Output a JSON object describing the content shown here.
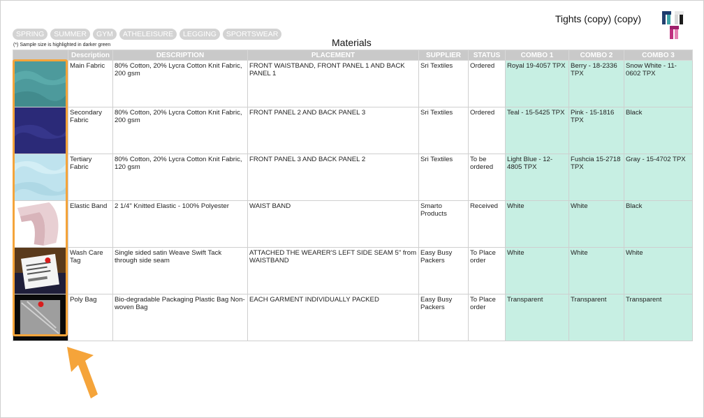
{
  "style_name": "Tights (copy) (copy)",
  "section_title": "Materials",
  "tags": [
    "SPRING",
    "SUMMER",
    "GYM",
    "ATHELEISURE",
    "LEGGING",
    "SPORTSWEAR"
  ],
  "note": "(*) Sample size is highlighted in darker green",
  "columns": [
    "",
    "Description",
    "DESCRIPTION",
    "PLACEMENT",
    "SUPPLIER",
    "STATUS",
    "COMBO 1",
    "COMBO 2",
    "COMBO 3"
  ],
  "rows": [
    {
      "image": "teal-fabric-swatch",
      "name": "Main Fabric",
      "description": "80% Cotton, 20% Lycra Cotton Knit Fabric, 200 gsm",
      "placement": "FRONT WAISTBAND, FRONT PANEL 1 AND BACK PANEL 1",
      "supplier": "Sri Textiles",
      "status": "Ordered",
      "combo1": "Royal 19-4057 TPX",
      "combo2": "Berry - 18-2336 TPX",
      "combo3": "Snow White - 11-0602 TPX"
    },
    {
      "image": "navy-fabric-swatch",
      "name": "Secondary Fabric",
      "description": "80% Cotton, 20% Lycra Cotton Knit Fabric, 200 gsm",
      "placement": "FRONT PANEL 2 AND BACK PANEL 3",
      "supplier": "Sri Textiles",
      "status": "Ordered",
      "combo1": "Teal - 15-5425 TPX",
      "combo2": "Pink - 15-1816 TPX",
      "combo3": "Black"
    },
    {
      "image": "light-blue-fabric-swatch",
      "name": "Tertiary Fabric",
      "description": "80% Cotton, 20% Lycra Cotton Knit Fabric, 120 gsm",
      "placement": "FRONT PANEL 3 AND BACK PANEL 2",
      "supplier": "Sri Textiles",
      "status": "To be ordered",
      "combo1": "Light Blue - 12-4805 TPX",
      "combo2": "Fushcia 15-2718 TPX",
      "combo3": "Gray - 15-4702 TPX"
    },
    {
      "image": "elastic-band-photo",
      "name": "Elastic Band",
      "description": "2 1/4\" Knitted Elastic - 100% Polyester",
      "placement": "WAIST BAND",
      "supplier": "Smarto Products",
      "status": "Received",
      "combo1": "White",
      "combo2": "White",
      "combo3": "Black"
    },
    {
      "image": "wash-care-tag-photo",
      "name": "Wash Care Tag",
      "description": "Single sided satin Weave Swift Tack through side seam",
      "placement": "ATTACHED THE WEARER'S LEFT SIDE SEAM 5\" from WAISTBAND",
      "supplier": "Easy Busy Packers",
      "status": "To Place order",
      "combo1": "White",
      "combo2": "White",
      "combo3": "White"
    },
    {
      "image": "poly-bag-photo",
      "name": "Poly Bag",
      "description": "Bio-degradable Packaging Plastic Bag Non-woven Bag",
      "placement": "EACH GARMENT INDIVIDUALLY PACKED",
      "supplier": "Easy Busy Packers",
      "status": "To Place order",
      "combo1": "Transparent",
      "combo2": "Transparent",
      "combo3": "Transparent"
    }
  ],
  "colors": {
    "combo_background": "#c7efe3",
    "header_background": "#c9c9c9",
    "highlight": "#f5a43a"
  }
}
